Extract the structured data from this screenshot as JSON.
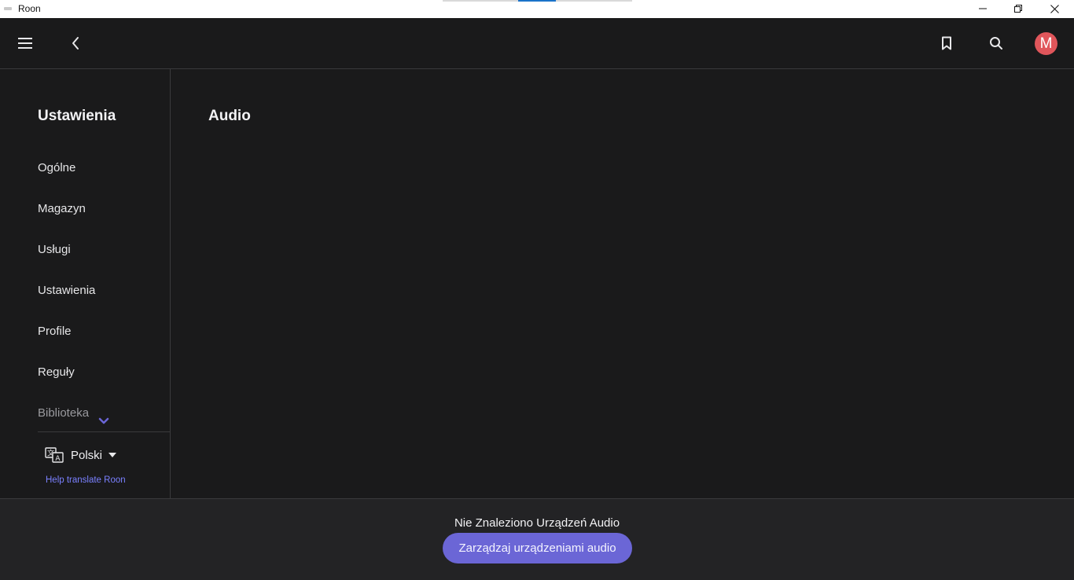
{
  "window": {
    "title": "Roon"
  },
  "appbar": {
    "avatar_letter": "M"
  },
  "sidebar": {
    "title": "Ustawienia",
    "items": [
      {
        "label": "Ogólne"
      },
      {
        "label": "Magazyn"
      },
      {
        "label": "Usługi"
      },
      {
        "label": "Ustawienia"
      },
      {
        "label": "Profile"
      },
      {
        "label": "Reguły"
      },
      {
        "label": "Biblioteka"
      }
    ],
    "language": "Polski",
    "help_link": "Help translate Roon"
  },
  "main": {
    "title": "Audio"
  },
  "bottombar": {
    "status": "Nie Znaleziono Urządzeń Audio",
    "button_label": "Zarządzaj urządzeniami audio"
  },
  "colors": {
    "accent": "#6b66d6",
    "link": "#7a80ff",
    "avatar": "#e0565b",
    "background": "#1a1a1b"
  },
  "icons": [
    "menu-icon",
    "back-icon",
    "bookmark-icon",
    "search-icon",
    "chevron-down-icon",
    "translate-icon",
    "caret-down-icon",
    "minimize-icon",
    "maximize-icon",
    "close-icon"
  ]
}
